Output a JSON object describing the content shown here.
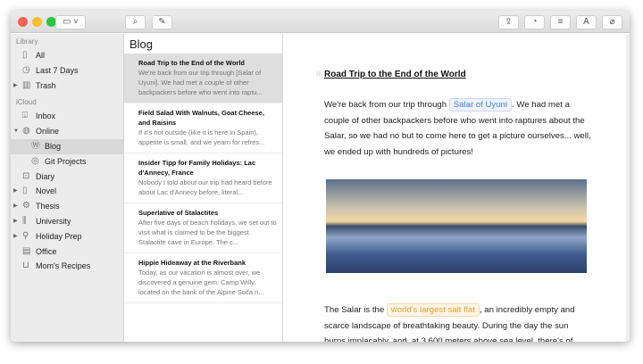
{
  "toolbar": {
    "sidebar_toggle": "sidebar-icon",
    "search": "search-icon",
    "compose": "compose-icon",
    "share": "share-icon",
    "stats": "gauge-icon",
    "toc": "list-icon",
    "typography": "A",
    "attach": "paperclip-icon"
  },
  "sidebar": {
    "library_label": "Library",
    "icloud_label": "iCloud",
    "items": [
      {
        "label": "All",
        "icon": "notebook-icon"
      },
      {
        "label": "Last 7 Days",
        "icon": "clock-icon"
      },
      {
        "label": "Trash",
        "icon": "trash-icon"
      },
      {
        "label": "Inbox",
        "icon": "inbox-icon"
      },
      {
        "label": "Online",
        "icon": "globe-icon"
      },
      {
        "label": "Blog",
        "icon": "wordpress-icon",
        "selected": true
      },
      {
        "label": "Git Projects",
        "icon": "github-icon"
      },
      {
        "label": "Diary",
        "icon": "lock-icon"
      },
      {
        "label": "Novel",
        "icon": "notebook-icon"
      },
      {
        "label": "Thesis",
        "icon": "gear-icon"
      },
      {
        "label": "University",
        "icon": "books-icon"
      },
      {
        "label": "Holiday Prep",
        "icon": "hiker-icon"
      },
      {
        "label": "Office",
        "icon": "building-icon"
      },
      {
        "label": "Mom's Recipes",
        "icon": "pot-icon"
      }
    ]
  },
  "list": {
    "title": "Blog",
    "notes": [
      {
        "title": "Road Trip to the End of the World",
        "preview": "We're back from our trip through [Salar of Uyuni]. We had met a couple of other backpackers before who went into raptu..."
      },
      {
        "title": "Field Salad With Walnuts, Goat Cheese, and Raisins",
        "preview": "If it's hot outside (like it is here in Spain), appetite is small, and we yearn for refres..."
      },
      {
        "title": "Insider Tipp for Family Holidays: Lac d'Annecy, France",
        "preview": "Nobody I told about our trip had heard before about Lac d'Annecy before, literal..."
      },
      {
        "title": "Superlative of Stalactites",
        "preview": "After five days of beach holidays, we set out to visit what is claimed to be the biggest Stalactite cave in Europe. The c..."
      },
      {
        "title": "Hippie Hideaway at the Riverbank",
        "preview": "Today, as our vacation is almost over, we discovered a genuine gem: Camp Willy, located on the bank of the Alpine Soča ri..."
      }
    ]
  },
  "editor": {
    "hash": "#",
    "heading": "Road Trip to the End of the World",
    "p1_a": "We're back from our trip through ",
    "p1_tag": "Salar of Uyuni",
    "p1_b": ". We had met a couple of other backpackers before who went into raptures about the Salar, so we had no but to come here to get a picture ourselves... well, we ended up with hundreds of pictures!",
    "p2_a": "The Salar is the ",
    "p2_tag": "world's largest salt flat",
    "p2_b": ", an incredibly empty and scarce landscape of breathtaking beauty. During the day the sun burns implacably, and, at 3,600 meters above sea level, there's of",
    "colors": {
      "tag_blue": "#4a7fd8",
      "tag_orange": "#e0a030"
    }
  }
}
